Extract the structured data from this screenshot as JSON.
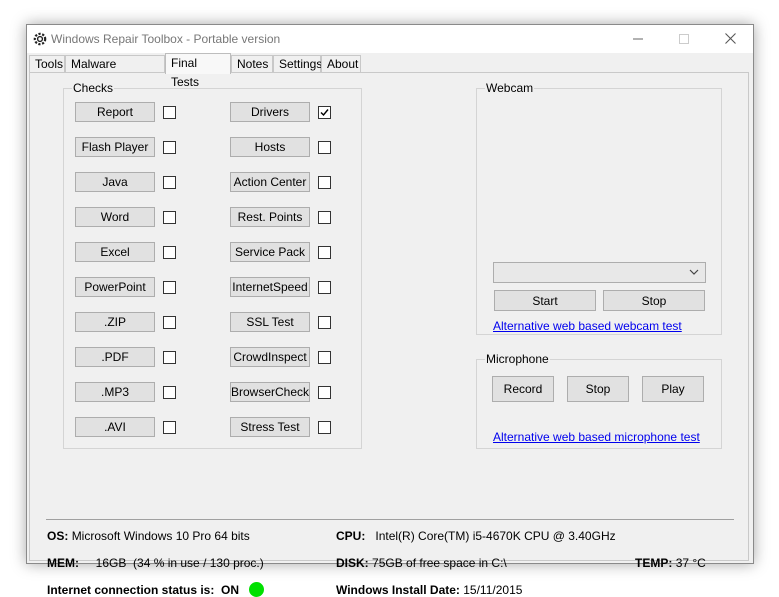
{
  "window": {
    "title": "Windows Repair Toolbox - Portable version"
  },
  "tabs": [
    {
      "label": "Tools"
    },
    {
      "label": "Malware Removal"
    },
    {
      "label": "Final Tests"
    },
    {
      "label": "Notes"
    },
    {
      "label": "Settings"
    },
    {
      "label": "About"
    }
  ],
  "checks": {
    "label": "Checks",
    "left": [
      {
        "label": "Report",
        "checked": false
      },
      {
        "label": "Flash Player",
        "checked": false
      },
      {
        "label": "Java",
        "checked": false
      },
      {
        "label": "Word",
        "checked": false
      },
      {
        "label": "Excel",
        "checked": false
      },
      {
        "label": "PowerPoint",
        "checked": false
      },
      {
        "label": ".ZIP",
        "checked": false
      },
      {
        "label": ".PDF",
        "checked": false
      },
      {
        "label": ".MP3",
        "checked": false
      },
      {
        "label": ".AVI",
        "checked": false
      }
    ],
    "right": [
      {
        "label": "Drivers",
        "checked": true
      },
      {
        "label": "Hosts",
        "checked": false
      },
      {
        "label": "Action Center",
        "checked": false
      },
      {
        "label": "Rest. Points",
        "checked": false
      },
      {
        "label": "Service Pack",
        "checked": false
      },
      {
        "label": "InternetSpeed",
        "checked": false
      },
      {
        "label": "SSL Test",
        "checked": false
      },
      {
        "label": "CrowdInspect",
        "checked": false
      },
      {
        "label": "BrowserCheck",
        "checked": false
      },
      {
        "label": "Stress Test",
        "checked": false
      }
    ]
  },
  "webcam": {
    "label": "Webcam",
    "device_value": "",
    "start_label": "Start",
    "stop_label": "Stop",
    "alt_link": "Alternative web based webcam test"
  },
  "microphone": {
    "label": "Microphone",
    "record_label": "Record",
    "stop_label": "Stop",
    "play_label": "Play",
    "alt_link": "Alternative web based microphone test"
  },
  "sysinfo": {
    "os_label": "OS:",
    "os_value": "Microsoft Windows 10 Pro 64 bits",
    "cpu_label": "CPU:",
    "cpu_value": "Intel(R) Core(TM) i5-4670K CPU @ 3.40GHz",
    "mem_label": "MEM:",
    "mem_value": "16GB  (34 % in use / 130 proc.)",
    "disk_label": "DISK:",
    "disk_value": "75GB of free space in C:\\",
    "temp_label": "TEMP:",
    "temp_value": "37 °C",
    "internet_label": "Internet connection status is:",
    "internet_value": "ON",
    "internet_status_color": "#00e000",
    "install_label": "Windows Install Date:",
    "install_value": "15/11/2015"
  }
}
